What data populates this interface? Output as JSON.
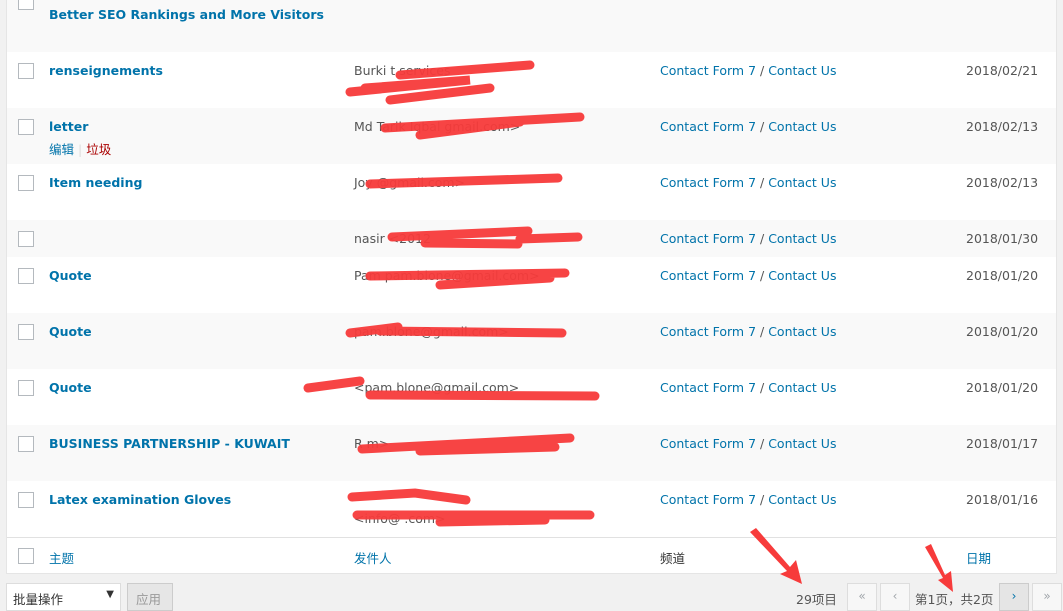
{
  "rows": [
    {
      "title": "Better SEO Rankings and More Visitors",
      "sender": "",
      "channel": "",
      "date": ""
    },
    {
      "title": "renseignements",
      "sender": "Burki                              t services",
      "sender2": "",
      "channel_form": "Contact Form 7",
      "channel_page": "Contact Us",
      "date": "2018/02/21"
    },
    {
      "title": "letter",
      "sender": "Md Tarik Iqbal                              gmail.com>",
      "channel_form": "Contact Form 7",
      "channel_page": "Contact Us",
      "date": "2018/02/13",
      "actions": {
        "edit": "编辑",
        "trash": "垃圾"
      }
    },
    {
      "title": "Item needing",
      "sender": "Joy                        @gmail.com>",
      "channel_form": "Contact Form 7",
      "channel_page": "Contact Us",
      "date": "2018/02/13"
    },
    {
      "title": "",
      "sender": "nasir  <2012",
      "channel_form": "Contact Form 7",
      "channel_page": "Contact Us",
      "date": "2018/01/30"
    },
    {
      "title": "Quote",
      "sender": "Pam           pam.blone@gmail.com>",
      "channel_form": "Contact Form 7",
      "channel_page": "Contact Us",
      "date": "2018/01/20"
    },
    {
      "title": "Quote",
      "sender": "                  pam.blone@gmail.com>",
      "channel_form": "Contact Form 7",
      "channel_page": "Contact Us",
      "date": "2018/01/20"
    },
    {
      "title": "Quote",
      "sender": "           <pam.blone@gmail.com>",
      "channel_form": "Contact Form 7",
      "channel_page": "Contact Us",
      "date": "2018/01/20"
    },
    {
      "title": "BUSINESS PARTNERSHIP - KUWAIT",
      "sender": "R                                        m>",
      "channel_form": "Contact Form 7",
      "channel_page": "Contact Us",
      "date": "2018/01/17"
    },
    {
      "title": "Latex examination Gloves",
      "sender": "",
      "sender2": "<info@                                .com>",
      "channel_form": "Contact Form 7",
      "channel_page": "Contact Us",
      "date": "2018/01/16"
    }
  ],
  "channel_sep": " / ",
  "footer": {
    "subject": "主题",
    "sender": "发件人",
    "channel": "频道",
    "date": "日期"
  },
  "tablenav": {
    "bulk_actions": "批量操作",
    "apply": "应用",
    "item_count": "29项目",
    "first": "«",
    "prev": "‹",
    "page_info": "第1页，共2页",
    "next": "›",
    "last": "»"
  },
  "colors": {
    "link": "#0073aa",
    "trash": "#aa0000",
    "redaction": "#f73b3b"
  }
}
